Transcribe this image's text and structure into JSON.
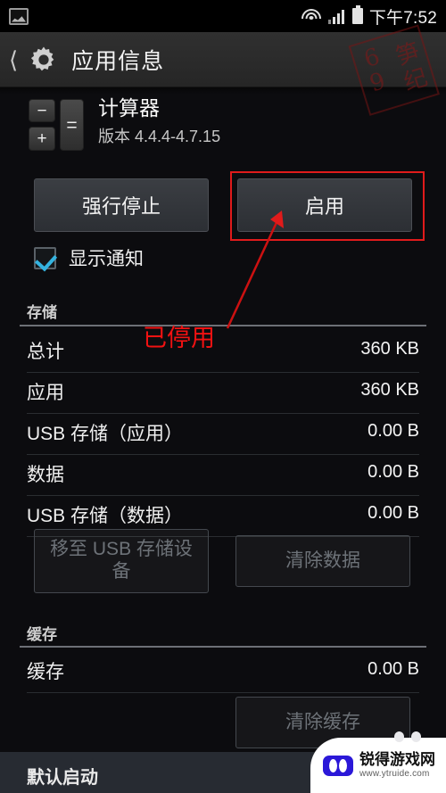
{
  "statusbar": {
    "notification_icon": "screenshot-icon",
    "wifi_icon": "wifi-icon",
    "signal_icon": "signal-bars-icon",
    "battery_icon": "battery-full-icon",
    "time": "下午7:52"
  },
  "actionbar": {
    "back_icon": "back-chevron-icon",
    "app_icon": "settings-gear-icon",
    "title": "应用信息"
  },
  "app": {
    "icon": "calculator-icon",
    "icon_keys": {
      "minus": "−",
      "plus": "+",
      "equals": "="
    },
    "name": "计算器",
    "version": "版本 4.4.4-4.7.15"
  },
  "buttons": {
    "force_stop": "强行停止",
    "enable": "启用"
  },
  "notifications": {
    "label": "显示通知",
    "checked": true
  },
  "storage": {
    "section_title": "存储",
    "rows": [
      {
        "label": "总计",
        "value": "360 KB"
      },
      {
        "label": "应用",
        "value": "360 KB"
      },
      {
        "label": "USB 存储（应用）",
        "value": "0.00 B"
      },
      {
        "label": "数据",
        "value": "0.00 B"
      },
      {
        "label": "USB 存储（数据）",
        "value": "0.00 B"
      }
    ],
    "move_button": "移至 USB 存储设备",
    "clear_data_button": "清除数据"
  },
  "cache": {
    "section_title": "缓存",
    "row": {
      "label": "缓存",
      "value": "0.00 B"
    },
    "clear_cache_button": "清除缓存"
  },
  "launch_by_default": {
    "section_title": "默认启动"
  },
  "annotations": {
    "highlight_label": "enable-button-highlight",
    "arrow": "pointer-arrow",
    "status_text": "已停用",
    "highlight_color": "#e01b1b"
  },
  "stamp": {
    "chars": [
      "6",
      "9",
      "笋",
      "纪"
    ]
  },
  "watermark": {
    "icon": "gamepad-icon",
    "name": "锐得游戏网",
    "url": "www.ytruide.com"
  }
}
